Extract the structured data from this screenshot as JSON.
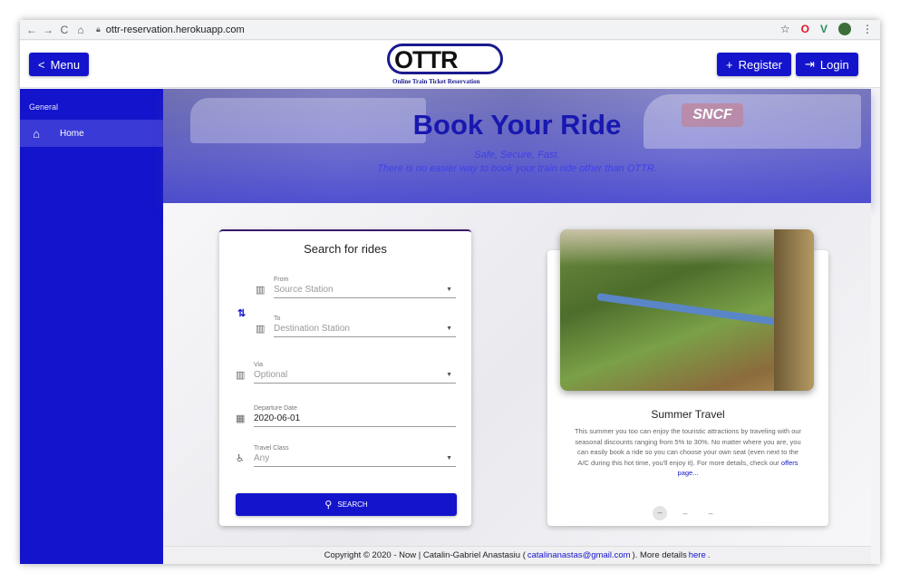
{
  "browser": {
    "url": "ottr-reservation.herokuapp.com",
    "back": "←",
    "forward": "→",
    "reload": "C",
    "home": "⌂"
  },
  "header": {
    "menu_label": "Menu",
    "menu_icon": "<",
    "logo_text": "OTTR",
    "logo_subtitle": "Online Train Ticket Reservation",
    "register_label": "Register",
    "register_icon": "+",
    "login_label": "Login",
    "login_icon": "⇥"
  },
  "sidebar": {
    "section": "General",
    "items": [
      {
        "label": "Home",
        "icon": "⌂"
      }
    ]
  },
  "hero": {
    "title": "Book Your Ride",
    "subtitle_line1": "Safe, Secure, Fast.",
    "subtitle_line2": "There is no easier way to book your train ride other than OTTR.",
    "sign_text": "SNCF"
  },
  "search": {
    "title": "Search for rides",
    "from_label": "From",
    "from_placeholder": "Source Station",
    "to_label": "To",
    "to_placeholder": "Destination Station",
    "via_label": "Via",
    "via_placeholder": "Optional",
    "date_label": "Departure Date",
    "date_value": "2020-06-01",
    "class_label": "Travel Class",
    "class_value": "Any",
    "button_label": "SEARCH"
  },
  "promo": {
    "title": "Summer Travel",
    "text": "This summer you too can enjoy the touristic attractions by traveling with our seasonal discounts ranging from 5% to 30%. No matter where you are, you can easily book a ride so you can choose your own seat (even next to the A/C during this hot time, you'll enjoy it). For more details, check our",
    "link": "offers page...",
    "carousel_active": "–",
    "carousel_dash": "–"
  },
  "footer": {
    "text_before": "Copyright © 2020 - Now | Catalin-Gabriel Anastasiu (",
    "email": "catalinanastas@gmail.com",
    "text_middle": "). More details",
    "here": "here",
    "text_end": "."
  },
  "colors": {
    "primary": "#1414cc",
    "sidebar_active": "#3a3ad6",
    "hero_title": "#1818b0"
  }
}
